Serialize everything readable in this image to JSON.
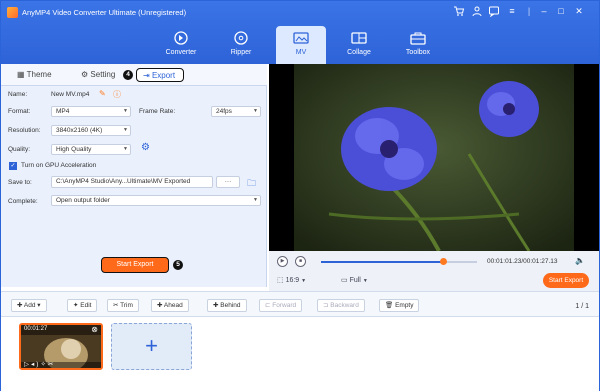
{
  "app": {
    "title": "AnyMP4 Video Converter Ultimate (Unregistered)"
  },
  "nav": {
    "tabs": [
      {
        "label": "Converter"
      },
      {
        "label": "Ripper"
      },
      {
        "label": "MV"
      },
      {
        "label": "Collage"
      },
      {
        "label": "Toolbox"
      }
    ],
    "active": "MV"
  },
  "mv_tabs": {
    "theme": "Theme",
    "setting": "Setting",
    "export": "Export"
  },
  "steps": {
    "export_step": "4",
    "start_step": "5"
  },
  "export_form": {
    "name_label": "Name:",
    "name_value": "New MV.mp4",
    "format_label": "Format:",
    "format_value": "MP4",
    "frame_rate_label": "Frame Rate:",
    "frame_rate_value": "24fps",
    "resolution_label": "Resolution:",
    "resolution_value": "3840x2160 (4K)",
    "quality_label": "Quality:",
    "quality_value": "High Quality",
    "gpu_label": "Turn on GPU Acceleration",
    "gpu_checked": true,
    "save_to_label": "Save to:",
    "save_to_value": "C:\\AnyMP4 Studio\\Any...Ultimate\\MV Exported",
    "browse": "···",
    "complete_label": "Complete:",
    "complete_value": "Open output folder"
  },
  "start_export": "Start Export",
  "player": {
    "time": "00:01:01.23/00:01:27.13",
    "progress": 0.78,
    "ratio": "16:9",
    "view": "Full"
  },
  "toolbar": {
    "add": "Add",
    "edit": "Edit",
    "trim": "Trim",
    "ahead": "Ahead",
    "behind": "Behind",
    "forward": "Forward",
    "backward": "Backward",
    "empty": "Empty",
    "page": "1 / 1"
  },
  "clip": {
    "duration": "00:01:27"
  },
  "colors": {
    "accent": "#2e63d8",
    "orange": "#ff6a1a"
  }
}
